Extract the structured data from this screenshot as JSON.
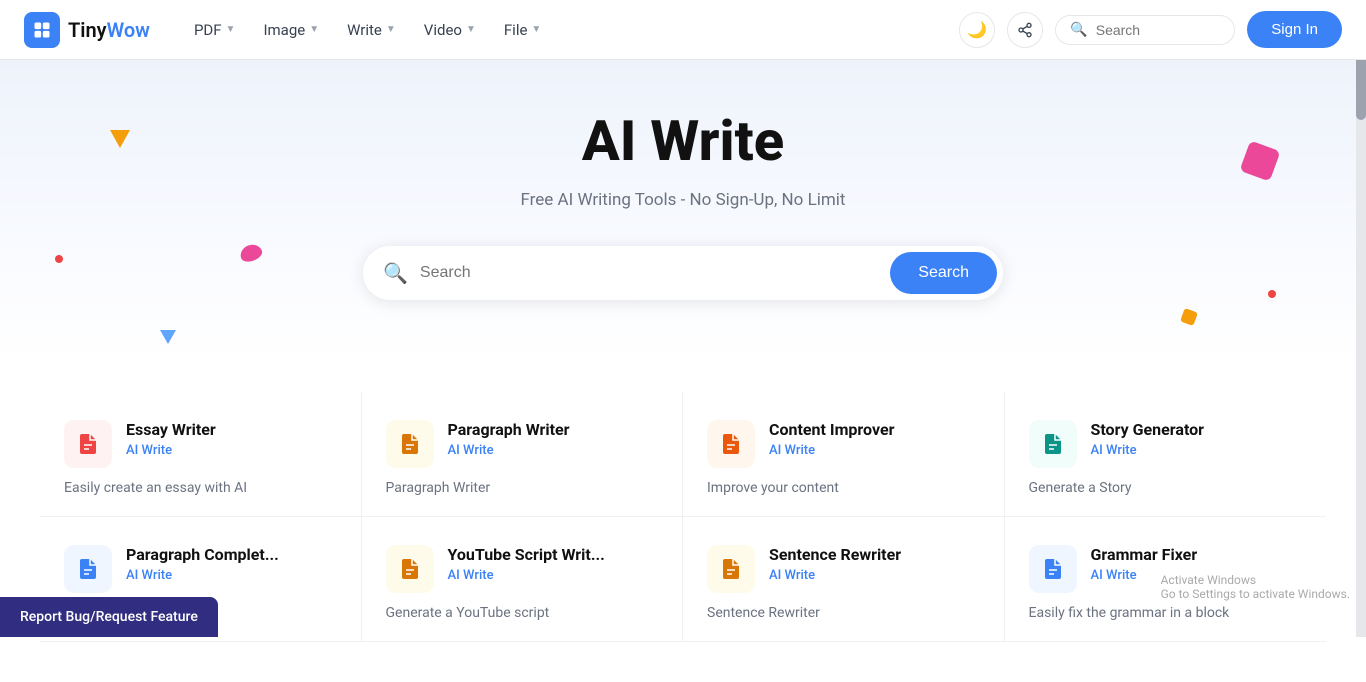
{
  "brand": {
    "tiny": "Tiny",
    "wow": "Wow",
    "logo_alt": "TinyWow logo"
  },
  "nav": {
    "items": [
      {
        "label": "PDF",
        "id": "pdf"
      },
      {
        "label": "Image",
        "id": "image"
      },
      {
        "label": "Write",
        "id": "write"
      },
      {
        "label": "Video",
        "id": "video"
      },
      {
        "label": "File",
        "id": "file"
      }
    ],
    "search_placeholder": "Search",
    "sign_in": "Sign In"
  },
  "hero": {
    "title": "AI Write",
    "subtitle": "Free AI Writing Tools - No Sign-Up, No Limit",
    "search_placeholder": "Search",
    "search_button": "Search"
  },
  "tools": [
    {
      "name": "Essay Writer",
      "category": "AI Write",
      "desc": "Easily create an essay with AI",
      "icon": "📄",
      "icon_class": "icon-red"
    },
    {
      "name": "Paragraph Writer",
      "category": "AI Write",
      "desc": "Paragraph Writer",
      "icon": "📄",
      "icon_class": "icon-yellow"
    },
    {
      "name": "Content Improver",
      "category": "AI Write",
      "desc": "Improve your content",
      "icon": "📄",
      "icon_class": "icon-orange"
    },
    {
      "name": "Story Generator",
      "category": "AI Write",
      "desc": "Generate a Story",
      "icon": "📄",
      "icon_class": "icon-teal"
    },
    {
      "name": "Paragraph Complet...",
      "category": "AI Write",
      "desc": "",
      "icon": "📄",
      "icon_class": "icon-blue"
    },
    {
      "name": "YouTube Script Writ...",
      "category": "AI Write",
      "desc": "Generate a YouTube script",
      "icon": "📄",
      "icon_class": "icon-yellow"
    },
    {
      "name": "Sentence Rewriter",
      "category": "AI Write",
      "desc": "Sentence Rewriter",
      "icon": "📄",
      "icon_class": "icon-yellow"
    },
    {
      "name": "Grammar Fixer",
      "category": "AI Write",
      "desc": "Easily fix the grammar in a block",
      "icon": "📄",
      "icon_class": "icon-blue"
    }
  ],
  "report_bug": {
    "label": "Report Bug/Request Feature"
  },
  "windows_watermark": {
    "line1": "Activate Windows",
    "line2": "Go to Settings to activate Windows."
  }
}
